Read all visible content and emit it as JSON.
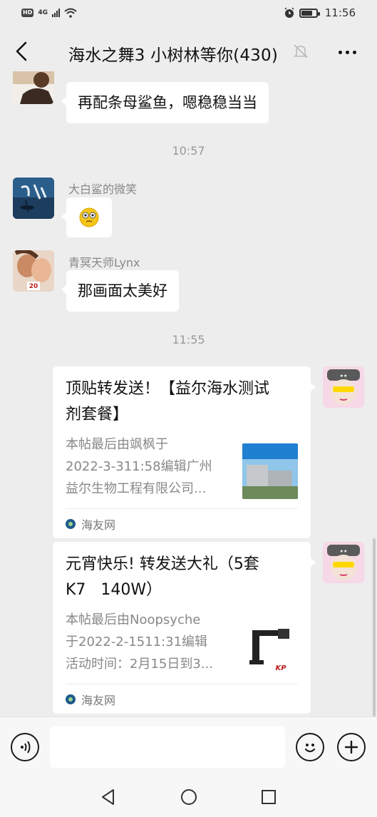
{
  "status_bar": {
    "hd_label": "HD",
    "network_label": "4G",
    "time": "11:56"
  },
  "header": {
    "title": "海水之舞3 小树林等你(430)",
    "icons": [
      "back-arrow-icon",
      "mute-bell-icon",
      "more-dots-icon"
    ]
  },
  "messages": {
    "m1": {
      "text": "再配条母鲨鱼，嗯稳稳当当"
    },
    "time1": "10:57",
    "m2": {
      "sender": "大白鲨的微笑",
      "content": "emoji-awkward-face"
    },
    "m3": {
      "sender": "青冥天师Lynx",
      "text": "那画面太美好"
    },
    "time2": "11:55",
    "card1": {
      "title_line1": "顶贴转发送！【益尔海水测试",
      "title_line2": "剂套餐】",
      "desc_line1": "本帖最后由飒枫于",
      "desc_line2": "2022-3-311:58编辑广州",
      "desc_line3": "益尔生物工程有限公司...",
      "source": "海友网"
    },
    "card2": {
      "title_line1": "元宵快乐! 转发送大礼（5套",
      "title_line2": "K7   140W）",
      "desc_line1": "本帖最后由Noopsyche",
      "desc_line2": "于2022-2-1511:31编辑",
      "desc_line3": "活动时间：2月15日到3...",
      "source": "海友网"
    }
  },
  "input_bar": {
    "placeholder": "",
    "icons": [
      "voice-icon",
      "emoji-icon",
      "plus-icon"
    ]
  },
  "nav_bar": {
    "icons": [
      "nav-back-triangle-icon",
      "nav-home-circle-icon",
      "nav-recents-square-icon"
    ]
  },
  "colors": {
    "background": "#ededed",
    "bubble": "#ffffff",
    "meta_text": "#999999"
  }
}
